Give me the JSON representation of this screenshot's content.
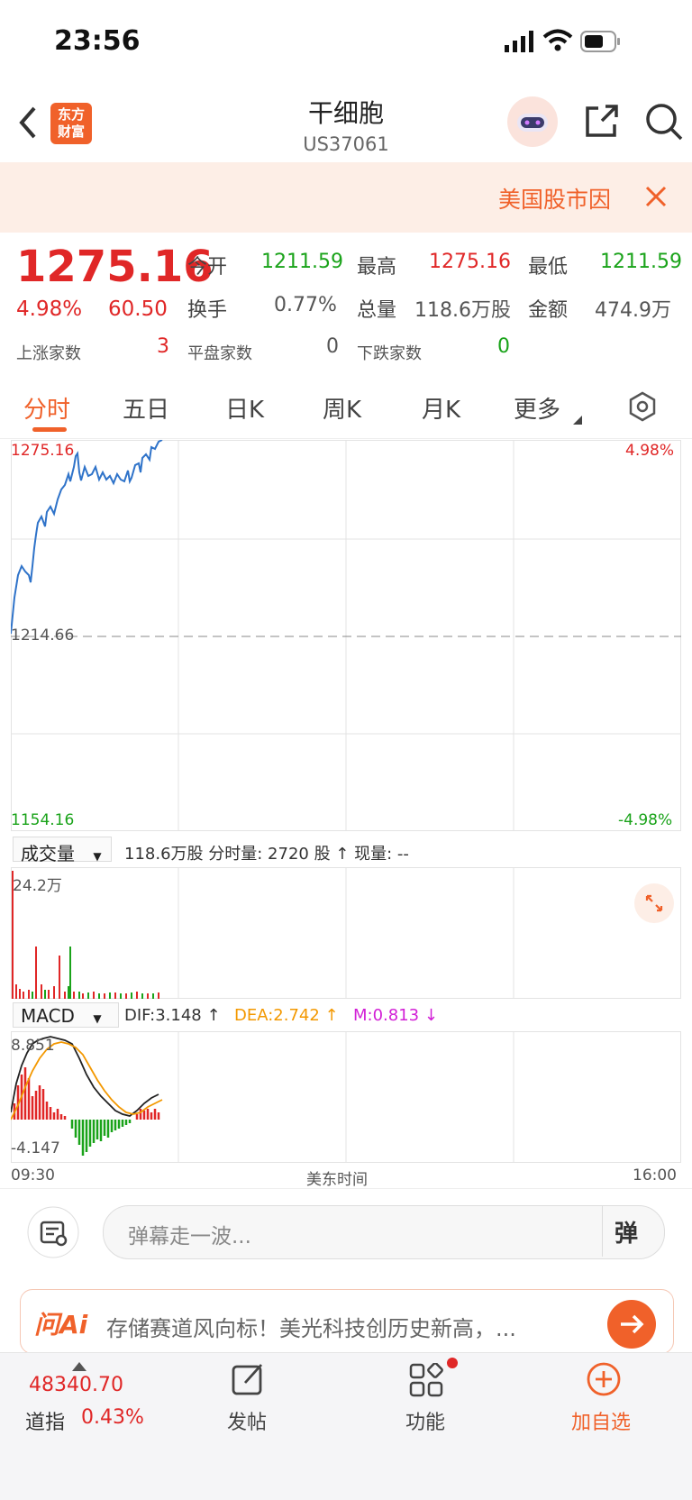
{
  "status": {
    "time": "23:56"
  },
  "header": {
    "logo_text_1": "东方",
    "logo_text_2": "财富",
    "title": "干细胞",
    "code": "US37061"
  },
  "banner": {
    "text": "美国股市因"
  },
  "quote": {
    "price": "1275.16",
    "change_pct": "4.98%",
    "change": "60.50",
    "open_label": "今开",
    "open": "1211.59",
    "high_label": "最高",
    "high": "1275.16",
    "low_label": "最低",
    "low": "1211.59",
    "turnover_label": "换手",
    "turnover": "0.77%",
    "volume_label": "总量",
    "volume": "118.6万股",
    "amount_label": "金额",
    "amount": "474.9万",
    "up_label": "上涨家数",
    "up": "3",
    "flat_label": "平盘家数",
    "flat": "0",
    "down_label": "下跌家数",
    "down": "0"
  },
  "tabs": [
    "分时",
    "五日",
    "日K",
    "周K",
    "月K",
    "更多"
  ],
  "chart": {
    "top_price": "1275.16",
    "mid_price": "1214.66",
    "bottom_price": "1154.16",
    "top_pct": "4.98%",
    "bottom_pct": "-4.98%"
  },
  "volume_bar": {
    "selector": "成交量",
    "info": "118.6万股 分时量: 2720 股 ↑ 现量: --",
    "max": "24.2万"
  },
  "macd_bar": {
    "selector": "MACD",
    "dif": "DIF:3.148 ↑",
    "dea": "DEA:2.742 ↑",
    "m": "M:0.813 ↓",
    "max": "8.851",
    "min": "-4.147"
  },
  "time_axis": {
    "start": "09:30",
    "mid": "美东时间",
    "end": "16:00"
  },
  "comment": {
    "placeholder": "弹幕走一波...",
    "danmu": "弹"
  },
  "ai": {
    "logo": "问Ai",
    "text": "存储赛道风向标！美光科技创历史新高，..."
  },
  "bottom_nav": {
    "index_value": "48340.70",
    "index_name": "道指",
    "index_pct": "0.43%",
    "post": "发帖",
    "func": "功能",
    "add": "加自选"
  },
  "colors": {
    "accent": "#f0612a",
    "up": "#e02727",
    "down": "#1aa31a",
    "line": "#2f73c9"
  }
}
